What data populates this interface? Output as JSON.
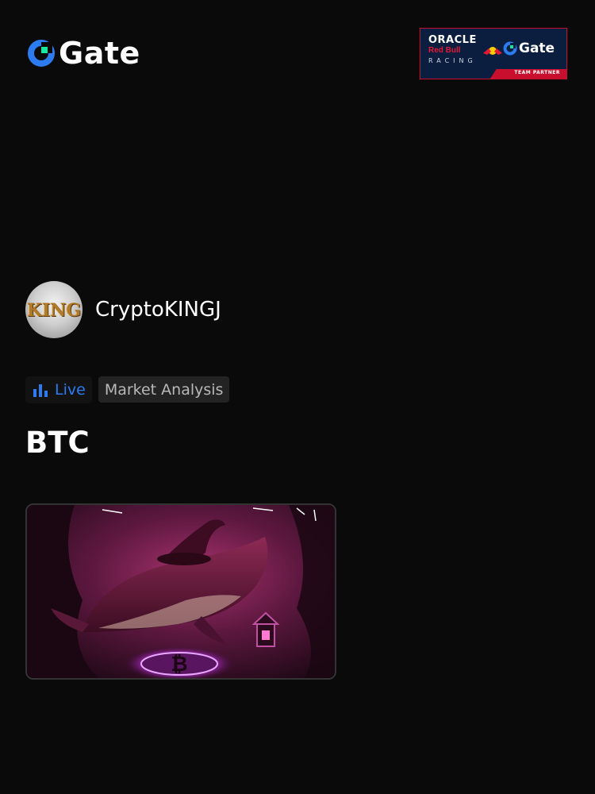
{
  "header": {
    "brand_name": "Gate",
    "partner_banner": {
      "line1": "ORACLE",
      "line2": "Red Bull",
      "line3": "RACING",
      "brand": "Gate",
      "strip": "TEAM PARTNER"
    }
  },
  "post": {
    "author_name": "CryptoKINGJ",
    "avatar_text": "KING",
    "tags": {
      "live": "Live",
      "category": "Market Analysis"
    },
    "title": "BTC",
    "image_icon": "bitcoin-whale-image"
  },
  "colors": {
    "background": "#0a0a0a",
    "brand_blue": "#2c7bf0",
    "brand_green": "#17e6a1",
    "partner_navy": "#0b1e3f",
    "partner_red": "#c8102e"
  }
}
